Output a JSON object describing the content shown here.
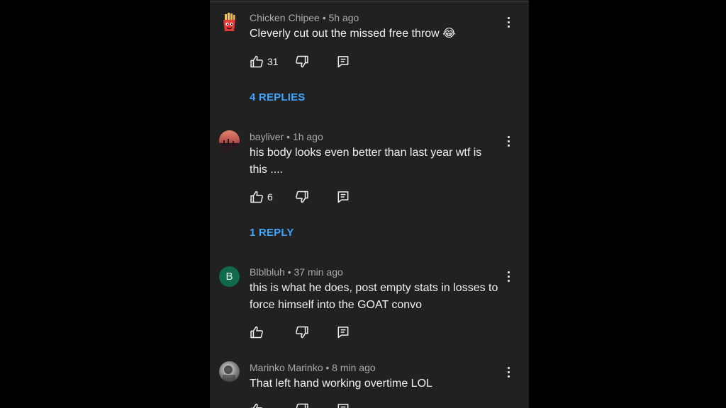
{
  "comments": [
    {
      "author": "Chicken Chipee",
      "time": "5h ago",
      "meta": "Chicken Chipee • 5h ago",
      "text": "Cleverly cut out the missed free throw 😂",
      "likes": "31",
      "replies_label": "4 REPLIES",
      "avatar_icon": "fries-icon"
    },
    {
      "author": "bayliver",
      "time": "1h ago",
      "meta": "bayliver • 1h ago",
      "text": "his body looks even better than last year wtf is this ....",
      "likes": "6",
      "replies_label": "1 REPLY",
      "avatar_icon": "sunset-photo"
    },
    {
      "author": "Blblbluh",
      "time": "37 min ago",
      "meta": "Blblbluh • 37 min ago",
      "text": "this is what he does, post empty stats in losses to force himself into the GOAT convo",
      "likes": "",
      "avatar_letter": "B",
      "avatar_color": "#0f6b4a"
    },
    {
      "author": "Marinko Marinko",
      "time": "8 min ago",
      "meta": "Marinko Marinko • 8 min ago",
      "text": "That left hand working overtime LOL",
      "likes": "",
      "avatar_icon": "bw-photo"
    }
  ],
  "colors": {
    "background": "#212121",
    "link": "#3ea6ff",
    "text": "#f1f1f1",
    "muted": "#aaaaaa"
  },
  "icons": [
    "thumbs-up-icon",
    "thumbs-down-icon",
    "reply-icon",
    "more-vert-icon"
  ]
}
